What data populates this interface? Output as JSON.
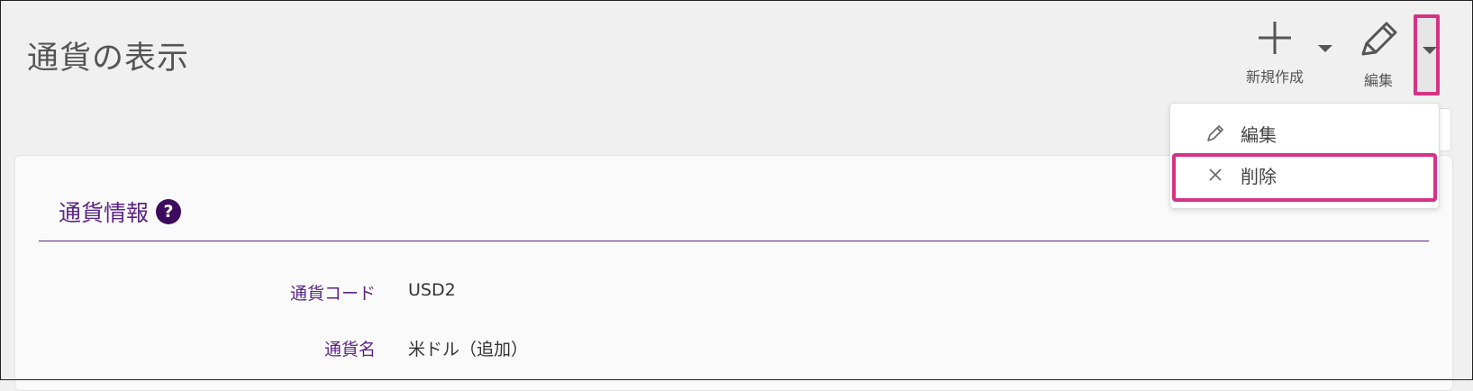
{
  "header": {
    "title": "通貨の表示",
    "new_label": "新規作成",
    "edit_label": "編集"
  },
  "menu": {
    "items": [
      {
        "icon": "pencil-icon",
        "label": "編集"
      },
      {
        "icon": "close-icon",
        "label": "削除"
      }
    ]
  },
  "section": {
    "title": "通貨情報",
    "help": "?"
  },
  "fields": [
    {
      "label": "通貨コード",
      "value": "USD2"
    },
    {
      "label": "通貨名",
      "value": "米ドル（追加）"
    }
  ],
  "colors": {
    "accent": "#5b2585",
    "highlight": "#d63384",
    "background": "#f0f0f0"
  }
}
